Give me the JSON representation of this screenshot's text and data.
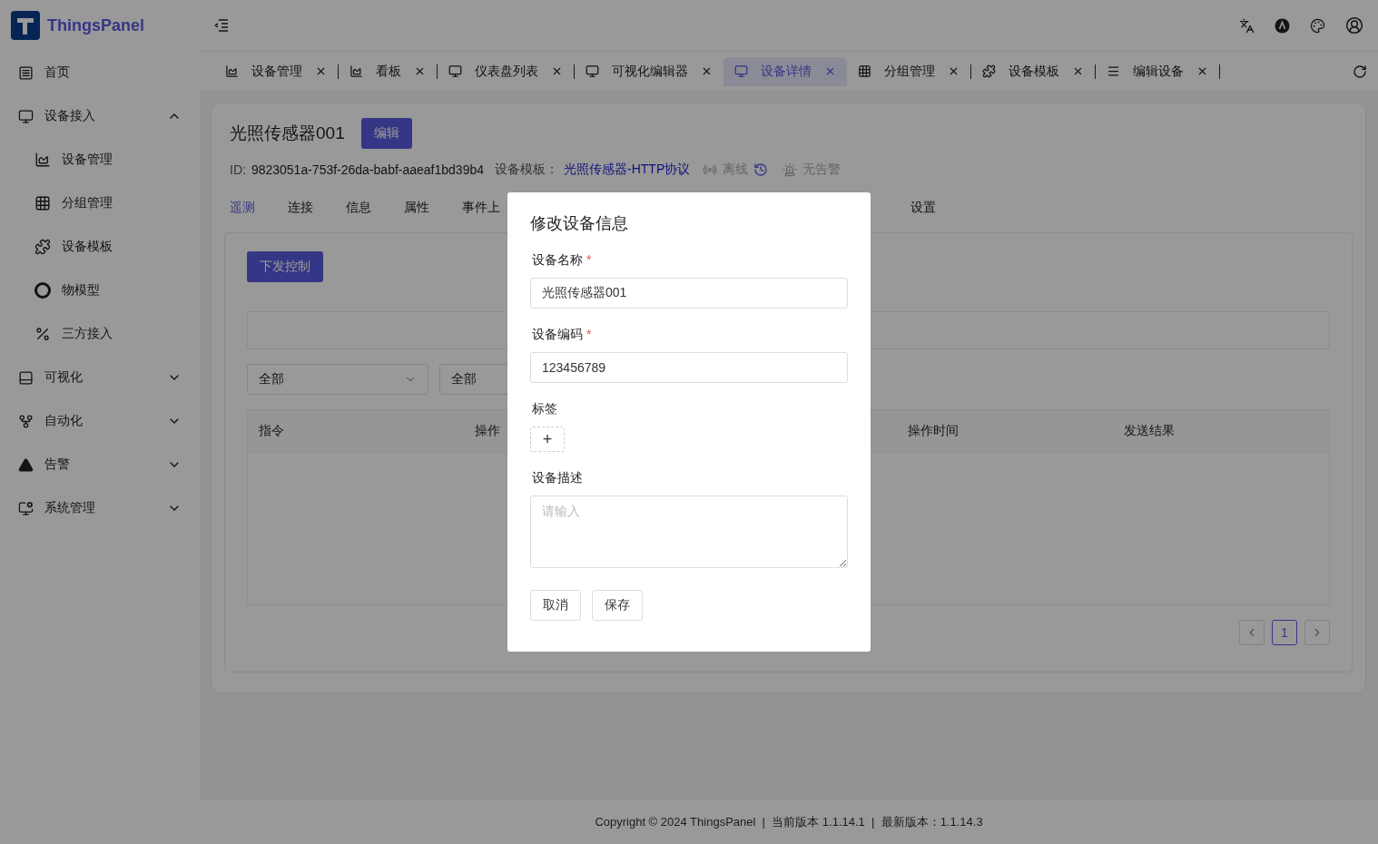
{
  "brand": {
    "name": "ThingsPanel"
  },
  "sidebar": {
    "items": [
      {
        "label": "首页"
      },
      {
        "label": "设备接入",
        "expanded": true,
        "children": [
          {
            "label": "设备管理"
          },
          {
            "label": "分组管理"
          },
          {
            "label": "设备模板"
          },
          {
            "label": "物模型"
          },
          {
            "label": "三方接入"
          }
        ]
      },
      {
        "label": "可视化",
        "expanded": false
      },
      {
        "label": "自动化",
        "expanded": false
      },
      {
        "label": "告警",
        "expanded": false
      },
      {
        "label": "系统管理",
        "expanded": false
      }
    ]
  },
  "page_tabs": [
    {
      "label": "设备管理",
      "selected": false
    },
    {
      "label": "看板",
      "selected": false
    },
    {
      "label": "仪表盘列表",
      "selected": false
    },
    {
      "label": "可视化编辑器",
      "selected": false
    },
    {
      "label": "设备详情",
      "selected": true
    },
    {
      "label": "分组管理",
      "selected": false
    },
    {
      "label": "设备模板",
      "selected": false
    },
    {
      "label": "编辑设备",
      "selected": false
    }
  ],
  "device": {
    "name": "光照传感器001",
    "edit_button": "编辑",
    "id_label": "ID:",
    "id": "9823051a-753f-26da-babf-aaeaf1bd39b4",
    "template_label": "设备模板：",
    "template": "光照传感器-HTTP协议",
    "status": {
      "label": "离线",
      "online": false
    },
    "alarm": "无告警"
  },
  "detail_tabs": [
    {
      "label": "遥测",
      "selected": true
    },
    {
      "label": "连接",
      "selected": false
    },
    {
      "label": "信息",
      "selected": false
    },
    {
      "label": "属性",
      "selected": false
    },
    {
      "label": "事件上",
      "selected": false
    },
    {
      "label": "设置",
      "selected": false
    }
  ],
  "control_button": "下发控制",
  "filters": [
    {
      "value": "全部"
    },
    {
      "value": "全部"
    }
  ],
  "table": {
    "columns": [
      "指令",
      "操作",
      "操作时间",
      "发送结果"
    ]
  },
  "pagination": {
    "pages": [
      {
        "label": "1",
        "selected": true
      }
    ]
  },
  "modal": {
    "title": "修改设备信息",
    "fields": [
      {
        "kind": "input",
        "label": "设备名称",
        "required_mark": "*",
        "value": "光照传感器001"
      },
      {
        "kind": "input",
        "label": "设备编码",
        "required_mark": "*",
        "value": "123456789"
      },
      {
        "kind": "tags",
        "label": "标签",
        "add": "+"
      },
      {
        "kind": "textarea",
        "label": "设备描述",
        "placeholder": "请输入"
      }
    ],
    "buttons": [
      "取消",
      "保存"
    ]
  },
  "footer": "Copyright © 2024 ThingsPanel  |  当前版本 1.1.14.1  |  最新版本：1.1.14.3"
}
